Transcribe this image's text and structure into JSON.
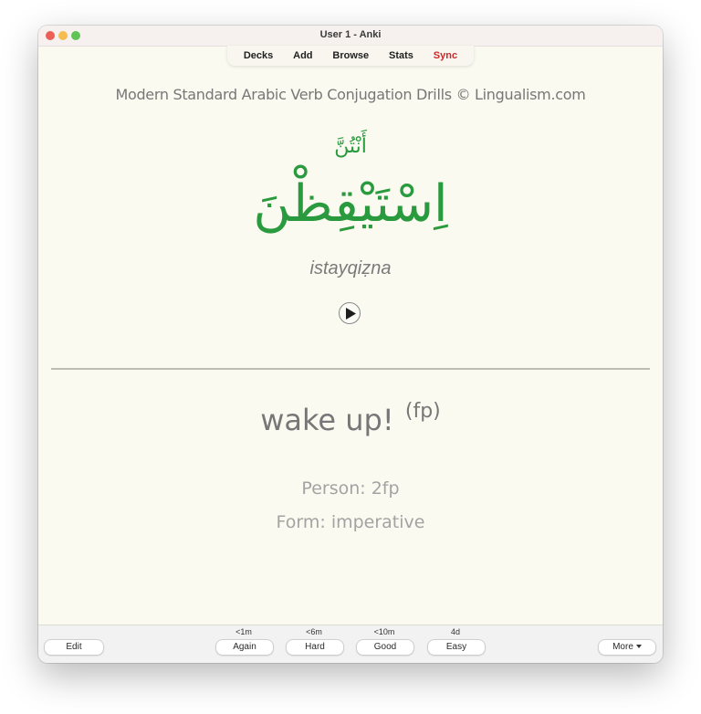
{
  "window": {
    "title": "User 1 - Anki"
  },
  "toolbar": {
    "items": [
      {
        "label": "Decks"
      },
      {
        "label": "Add"
      },
      {
        "label": "Browse"
      },
      {
        "label": "Stats"
      },
      {
        "label": "Sync"
      }
    ],
    "sync_color": "#cc2a2a"
  },
  "card": {
    "deck_title": "Modern Standard Arabic Verb Conjugation Drills © Lingualism.com",
    "pronoun": "أَنْتُنَّ",
    "verb": "اِسْتَيْقِظْنَ",
    "transliteration": "istayqiẓna",
    "accent_color": "#2a9a3e",
    "audio_icon": "play-icon",
    "meaning": "wake up!",
    "meaning_note": "(fp)",
    "person": "Person: 2fp",
    "form": "Form: imperative"
  },
  "bottombar": {
    "edit_label": "Edit",
    "more_label": "More",
    "answers": [
      {
        "label": "Again",
        "interval": "<1m"
      },
      {
        "label": "Hard",
        "interval": "<6m"
      },
      {
        "label": "Good",
        "interval": "<10m"
      },
      {
        "label": "Easy",
        "interval": "4d"
      }
    ]
  }
}
